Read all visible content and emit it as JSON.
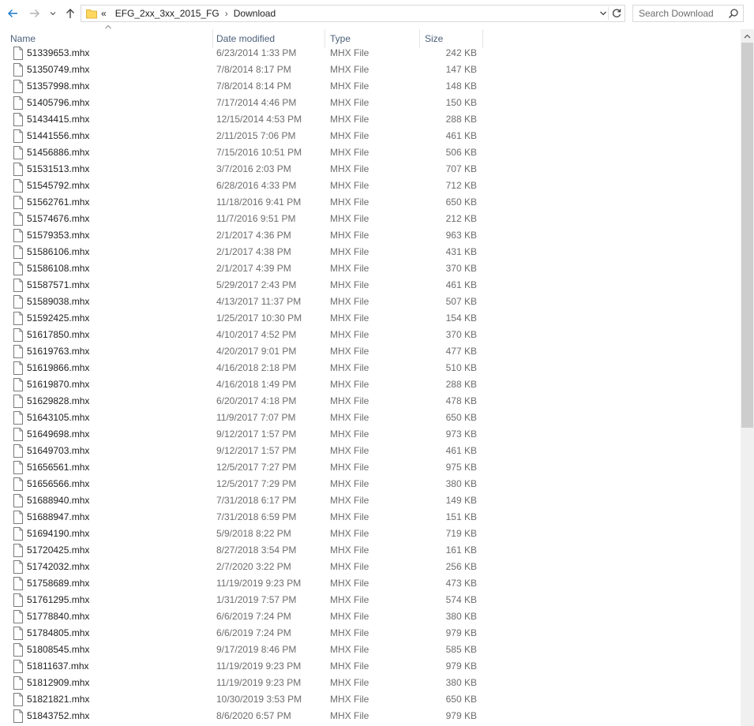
{
  "nav": {
    "back_icon": "arrow-left-icon",
    "forward_icon": "arrow-right-icon",
    "recent_icon": "chevron-down-icon",
    "up_icon": "arrow-up-icon"
  },
  "address": {
    "overflow": "«",
    "crumbs": [
      "EFG_2xx_3xx_2015_FG",
      "Download"
    ],
    "separator": "›"
  },
  "search": {
    "placeholder": "Search Download"
  },
  "columns": {
    "name": "Name",
    "date": "Date modified",
    "type": "Type",
    "size": "Size"
  },
  "files": [
    {
      "name": "51339653.mhx",
      "date": "6/23/2014 1:33 PM",
      "type": "MHX File",
      "size": "242 KB"
    },
    {
      "name": "51350749.mhx",
      "date": "7/8/2014 8:17 PM",
      "type": "MHX File",
      "size": "147 KB"
    },
    {
      "name": "51357998.mhx",
      "date": "7/8/2014 8:14 PM",
      "type": "MHX File",
      "size": "148 KB"
    },
    {
      "name": "51405796.mhx",
      "date": "7/17/2014 4:46 PM",
      "type": "MHX File",
      "size": "150 KB"
    },
    {
      "name": "51434415.mhx",
      "date": "12/15/2014 4:53 PM",
      "type": "MHX File",
      "size": "288 KB"
    },
    {
      "name": "51441556.mhx",
      "date": "2/11/2015 7:06 PM",
      "type": "MHX File",
      "size": "461 KB"
    },
    {
      "name": "51456886.mhx",
      "date": "7/15/2016 10:51 PM",
      "type": "MHX File",
      "size": "506 KB"
    },
    {
      "name": "51531513.mhx",
      "date": "3/7/2016 2:03 PM",
      "type": "MHX File",
      "size": "707 KB"
    },
    {
      "name": "51545792.mhx",
      "date": "6/28/2016 4:33 PM",
      "type": "MHX File",
      "size": "712 KB"
    },
    {
      "name": "51562761.mhx",
      "date": "11/18/2016 9:41 PM",
      "type": "MHX File",
      "size": "650 KB"
    },
    {
      "name": "51574676.mhx",
      "date": "11/7/2016 9:51 PM",
      "type": "MHX File",
      "size": "212 KB"
    },
    {
      "name": "51579353.mhx",
      "date": "2/1/2017 4:36 PM",
      "type": "MHX File",
      "size": "963 KB"
    },
    {
      "name": "51586106.mhx",
      "date": "2/1/2017 4:38 PM",
      "type": "MHX File",
      "size": "431 KB"
    },
    {
      "name": "51586108.mhx",
      "date": "2/1/2017 4:39 PM",
      "type": "MHX File",
      "size": "370 KB"
    },
    {
      "name": "51587571.mhx",
      "date": "5/29/2017 2:43 PM",
      "type": "MHX File",
      "size": "461 KB"
    },
    {
      "name": "51589038.mhx",
      "date": "4/13/2017 11:37 PM",
      "type": "MHX File",
      "size": "507 KB"
    },
    {
      "name": "51592425.mhx",
      "date": "1/25/2017 10:30 PM",
      "type": "MHX File",
      "size": "154 KB"
    },
    {
      "name": "51617850.mhx",
      "date": "4/10/2017 4:52 PM",
      "type": "MHX File",
      "size": "370 KB"
    },
    {
      "name": "51619763.mhx",
      "date": "4/20/2017 9:01 PM",
      "type": "MHX File",
      "size": "477 KB"
    },
    {
      "name": "51619866.mhx",
      "date": "4/16/2018 2:18 PM",
      "type": "MHX File",
      "size": "510 KB"
    },
    {
      "name": "51619870.mhx",
      "date": "4/16/2018 1:49 PM",
      "type": "MHX File",
      "size": "288 KB"
    },
    {
      "name": "51629828.mhx",
      "date": "6/20/2017 4:18 PM",
      "type": "MHX File",
      "size": "478 KB"
    },
    {
      "name": "51643105.mhx",
      "date": "11/9/2017 7:07 PM",
      "type": "MHX File",
      "size": "650 KB"
    },
    {
      "name": "51649698.mhx",
      "date": "9/12/2017 1:57 PM",
      "type": "MHX File",
      "size": "973 KB"
    },
    {
      "name": "51649703.mhx",
      "date": "9/12/2017 1:57 PM",
      "type": "MHX File",
      "size": "461 KB"
    },
    {
      "name": "51656561.mhx",
      "date": "12/5/2017 7:27 PM",
      "type": "MHX File",
      "size": "975 KB"
    },
    {
      "name": "51656566.mhx",
      "date": "12/5/2017 7:29 PM",
      "type": "MHX File",
      "size": "380 KB"
    },
    {
      "name": "51688940.mhx",
      "date": "7/31/2018 6:17 PM",
      "type": "MHX File",
      "size": "149 KB"
    },
    {
      "name": "51688947.mhx",
      "date": "7/31/2018 6:59 PM",
      "type": "MHX File",
      "size": "151 KB"
    },
    {
      "name": "51694190.mhx",
      "date": "5/9/2018 8:22 PM",
      "type": "MHX File",
      "size": "719 KB"
    },
    {
      "name": "51720425.mhx",
      "date": "8/27/2018 3:54 PM",
      "type": "MHX File",
      "size": "161 KB"
    },
    {
      "name": "51742032.mhx",
      "date": "2/7/2020 3:22 PM",
      "type": "MHX File",
      "size": "256 KB"
    },
    {
      "name": "51758689.mhx",
      "date": "11/19/2019 9:23 PM",
      "type": "MHX File",
      "size": "473 KB"
    },
    {
      "name": "51761295.mhx",
      "date": "1/31/2019 7:57 PM",
      "type": "MHX File",
      "size": "574 KB"
    },
    {
      "name": "51778840.mhx",
      "date": "6/6/2019 7:24 PM",
      "type": "MHX File",
      "size": "380 KB"
    },
    {
      "name": "51784805.mhx",
      "date": "6/6/2019 7:24 PM",
      "type": "MHX File",
      "size": "979 KB"
    },
    {
      "name": "51808545.mhx",
      "date": "9/17/2019 8:46 PM",
      "type": "MHX File",
      "size": "585 KB"
    },
    {
      "name": "51811637.mhx",
      "date": "11/19/2019 9:23 PM",
      "type": "MHX File",
      "size": "979 KB"
    },
    {
      "name": "51812909.mhx",
      "date": "11/19/2019 9:23 PM",
      "type": "MHX File",
      "size": "380 KB"
    },
    {
      "name": "51821821.mhx",
      "date": "10/30/2019 3:53 PM",
      "type": "MHX File",
      "size": "650 KB"
    },
    {
      "name": "51843752.mhx",
      "date": "8/6/2020 6:57 PM",
      "type": "MHX File",
      "size": "979 KB"
    }
  ],
  "colors": {
    "accent": "#1979ca",
    "header_text": "#4c607a",
    "folder": "#ffd75e"
  }
}
